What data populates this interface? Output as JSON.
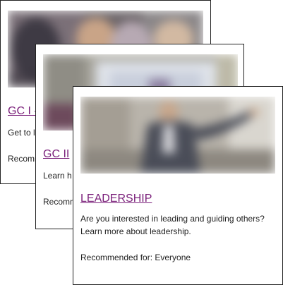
{
  "cards": [
    {
      "title": "GC I -",
      "description": "Get to l",
      "recommended": "Recomme"
    },
    {
      "title": "GC II",
      "description": "Learn h",
      "recommended": "Recomm"
    },
    {
      "title": "LEADERSHIP",
      "description": "Are you interested in leading and guiding others? Learn more about leadership.",
      "recommended": "Recommended for: Everyone"
    }
  ],
  "colors": {
    "link": "#7a1f7a",
    "text": "#222222",
    "border": "#222222"
  }
}
